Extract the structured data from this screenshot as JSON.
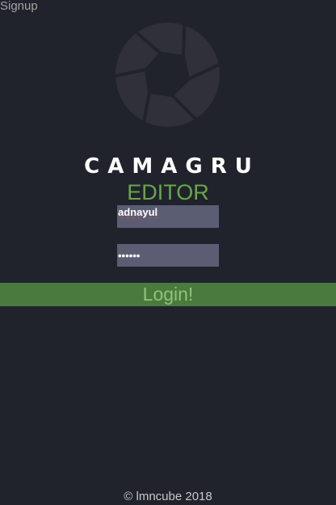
{
  "nav": {
    "signup_label": "Signup"
  },
  "brand": {
    "title": "CAMAGRU",
    "subtitle": "EDITOR",
    "logo_icon": "camera-aperture-icon"
  },
  "form": {
    "username_value": "adnayul",
    "password_value": "••••••",
    "login_label": "Login!"
  },
  "footer": {
    "text": "© lmncube 2018"
  },
  "colors": {
    "background": "#20232c",
    "accent_green": "#68a749",
    "button_green": "#4a7a3e",
    "input_bg": "#5b5e73",
    "logo": "#2f3039"
  }
}
